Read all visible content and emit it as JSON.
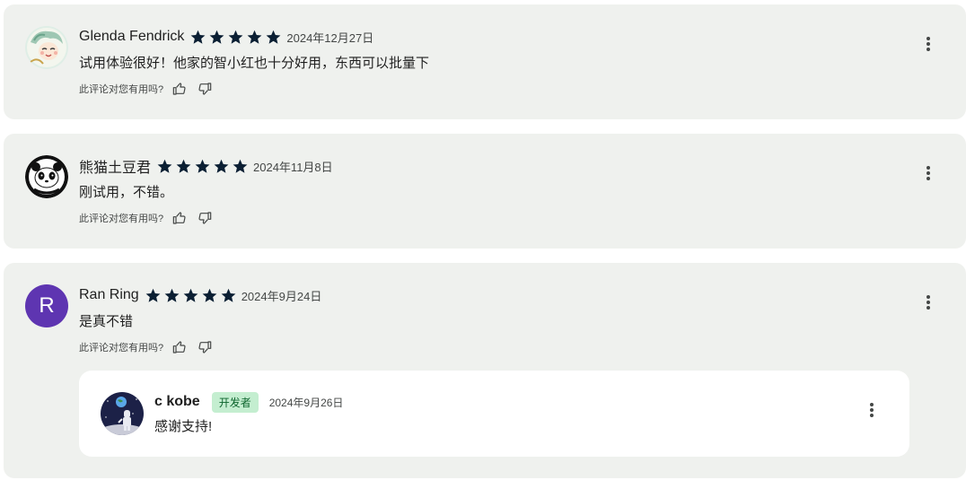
{
  "colors": {
    "star": "#0b1f33",
    "card_bg": "#eff1ee",
    "avatar_r_bg": "#5e35b1",
    "dev_badge_bg": "#c4eed0",
    "dev_badge_text": "#0d652d"
  },
  "reviews": [
    {
      "author": "Glenda Fendrick",
      "avatar": "illustrated-character-avatar",
      "rating": 5,
      "date": "2024年12月27日",
      "text": "试用体验很好！他家的智小红也十分好用，东西可以批量下",
      "helpful_prompt": "此评论对您有用吗?"
    },
    {
      "author": "熊猫土豆君",
      "avatar": "panda-avatar",
      "rating": 5,
      "date": "2024年11月8日",
      "text": "刚试用，不错。",
      "helpful_prompt": "此评论对您有用吗?"
    },
    {
      "author": "Ran Ring",
      "avatar_letter": "R",
      "rating": 5,
      "date": "2024年9月24日",
      "text": "是真不错",
      "helpful_prompt": "此评论对您有用吗?",
      "reply": {
        "author": "c kobe",
        "avatar": "astronaut-avatar",
        "badge": "开发者",
        "date": "2024年9月26日",
        "text": "感谢支持!"
      }
    }
  ]
}
